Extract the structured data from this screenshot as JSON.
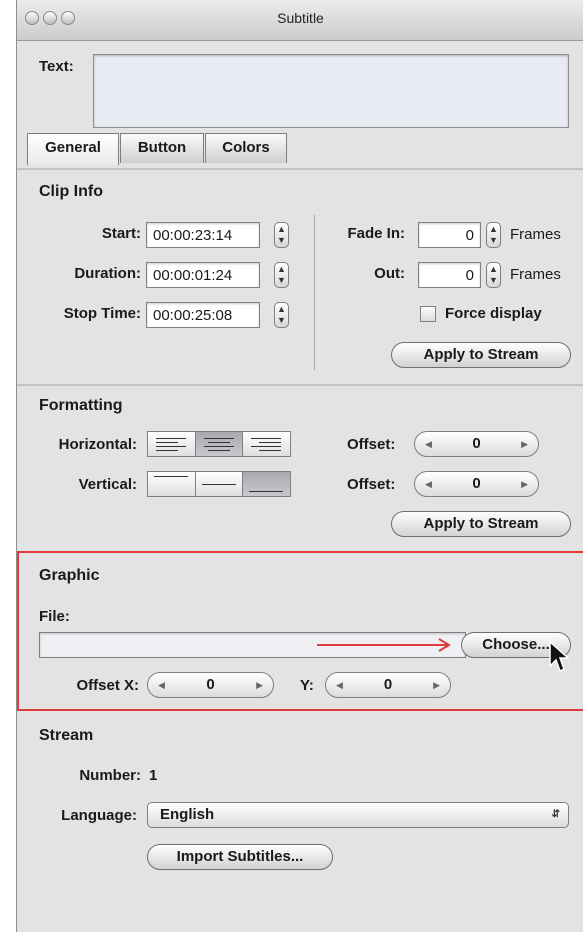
{
  "window": {
    "title": "Subtitle"
  },
  "text_field": {
    "label": "Text:",
    "value": ""
  },
  "tabs": [
    {
      "label": "General",
      "active": true
    },
    {
      "label": "Button",
      "active": false
    },
    {
      "label": "Colors",
      "active": false
    }
  ],
  "clip_info": {
    "title": "Clip Info",
    "start_label": "Start:",
    "start_value": "00:00:23:14",
    "duration_label": "Duration:",
    "duration_value": "00:00:01:24",
    "stop_label": "Stop Time:",
    "stop_value": "00:00:25:08",
    "fade_in_label": "Fade In:",
    "fade_in_value": "0",
    "out_label": "Out:",
    "out_value": "0",
    "frames_unit": "Frames",
    "force_display_label": "Force display",
    "force_display_checked": false,
    "apply_label": "Apply to Stream"
  },
  "formatting": {
    "title": "Formatting",
    "horizontal_label": "Horizontal:",
    "horizontal_selected": "center",
    "vertical_label": "Vertical:",
    "vertical_selected": "bottom",
    "offset_label": "Offset:",
    "h_offset_value": "0",
    "v_offset_value": "0",
    "apply_label": "Apply to Stream"
  },
  "graphic": {
    "title": "Graphic",
    "file_label": "File:",
    "file_value": "",
    "choose_label": "Choose...",
    "offset_x_label": "Offset X:",
    "offset_x_value": "0",
    "y_label": "Y:",
    "y_value": "0",
    "highlight_color": "#e23b3b"
  },
  "stream": {
    "title": "Stream",
    "number_label": "Number:",
    "number_value": "1",
    "language_label": "Language:",
    "language_value": "English",
    "import_label": "Import Subtitles..."
  },
  "icons": [
    "close-icon",
    "minimize-icon",
    "zoom-icon",
    "stepper-icon",
    "align-left-icon",
    "align-center-icon",
    "align-right-icon",
    "align-top-icon",
    "align-middle-icon",
    "align-bottom-icon",
    "arrow-left-icon",
    "arrow-right-icon",
    "chevron-updown-icon",
    "mouse-pointer-icon"
  ]
}
